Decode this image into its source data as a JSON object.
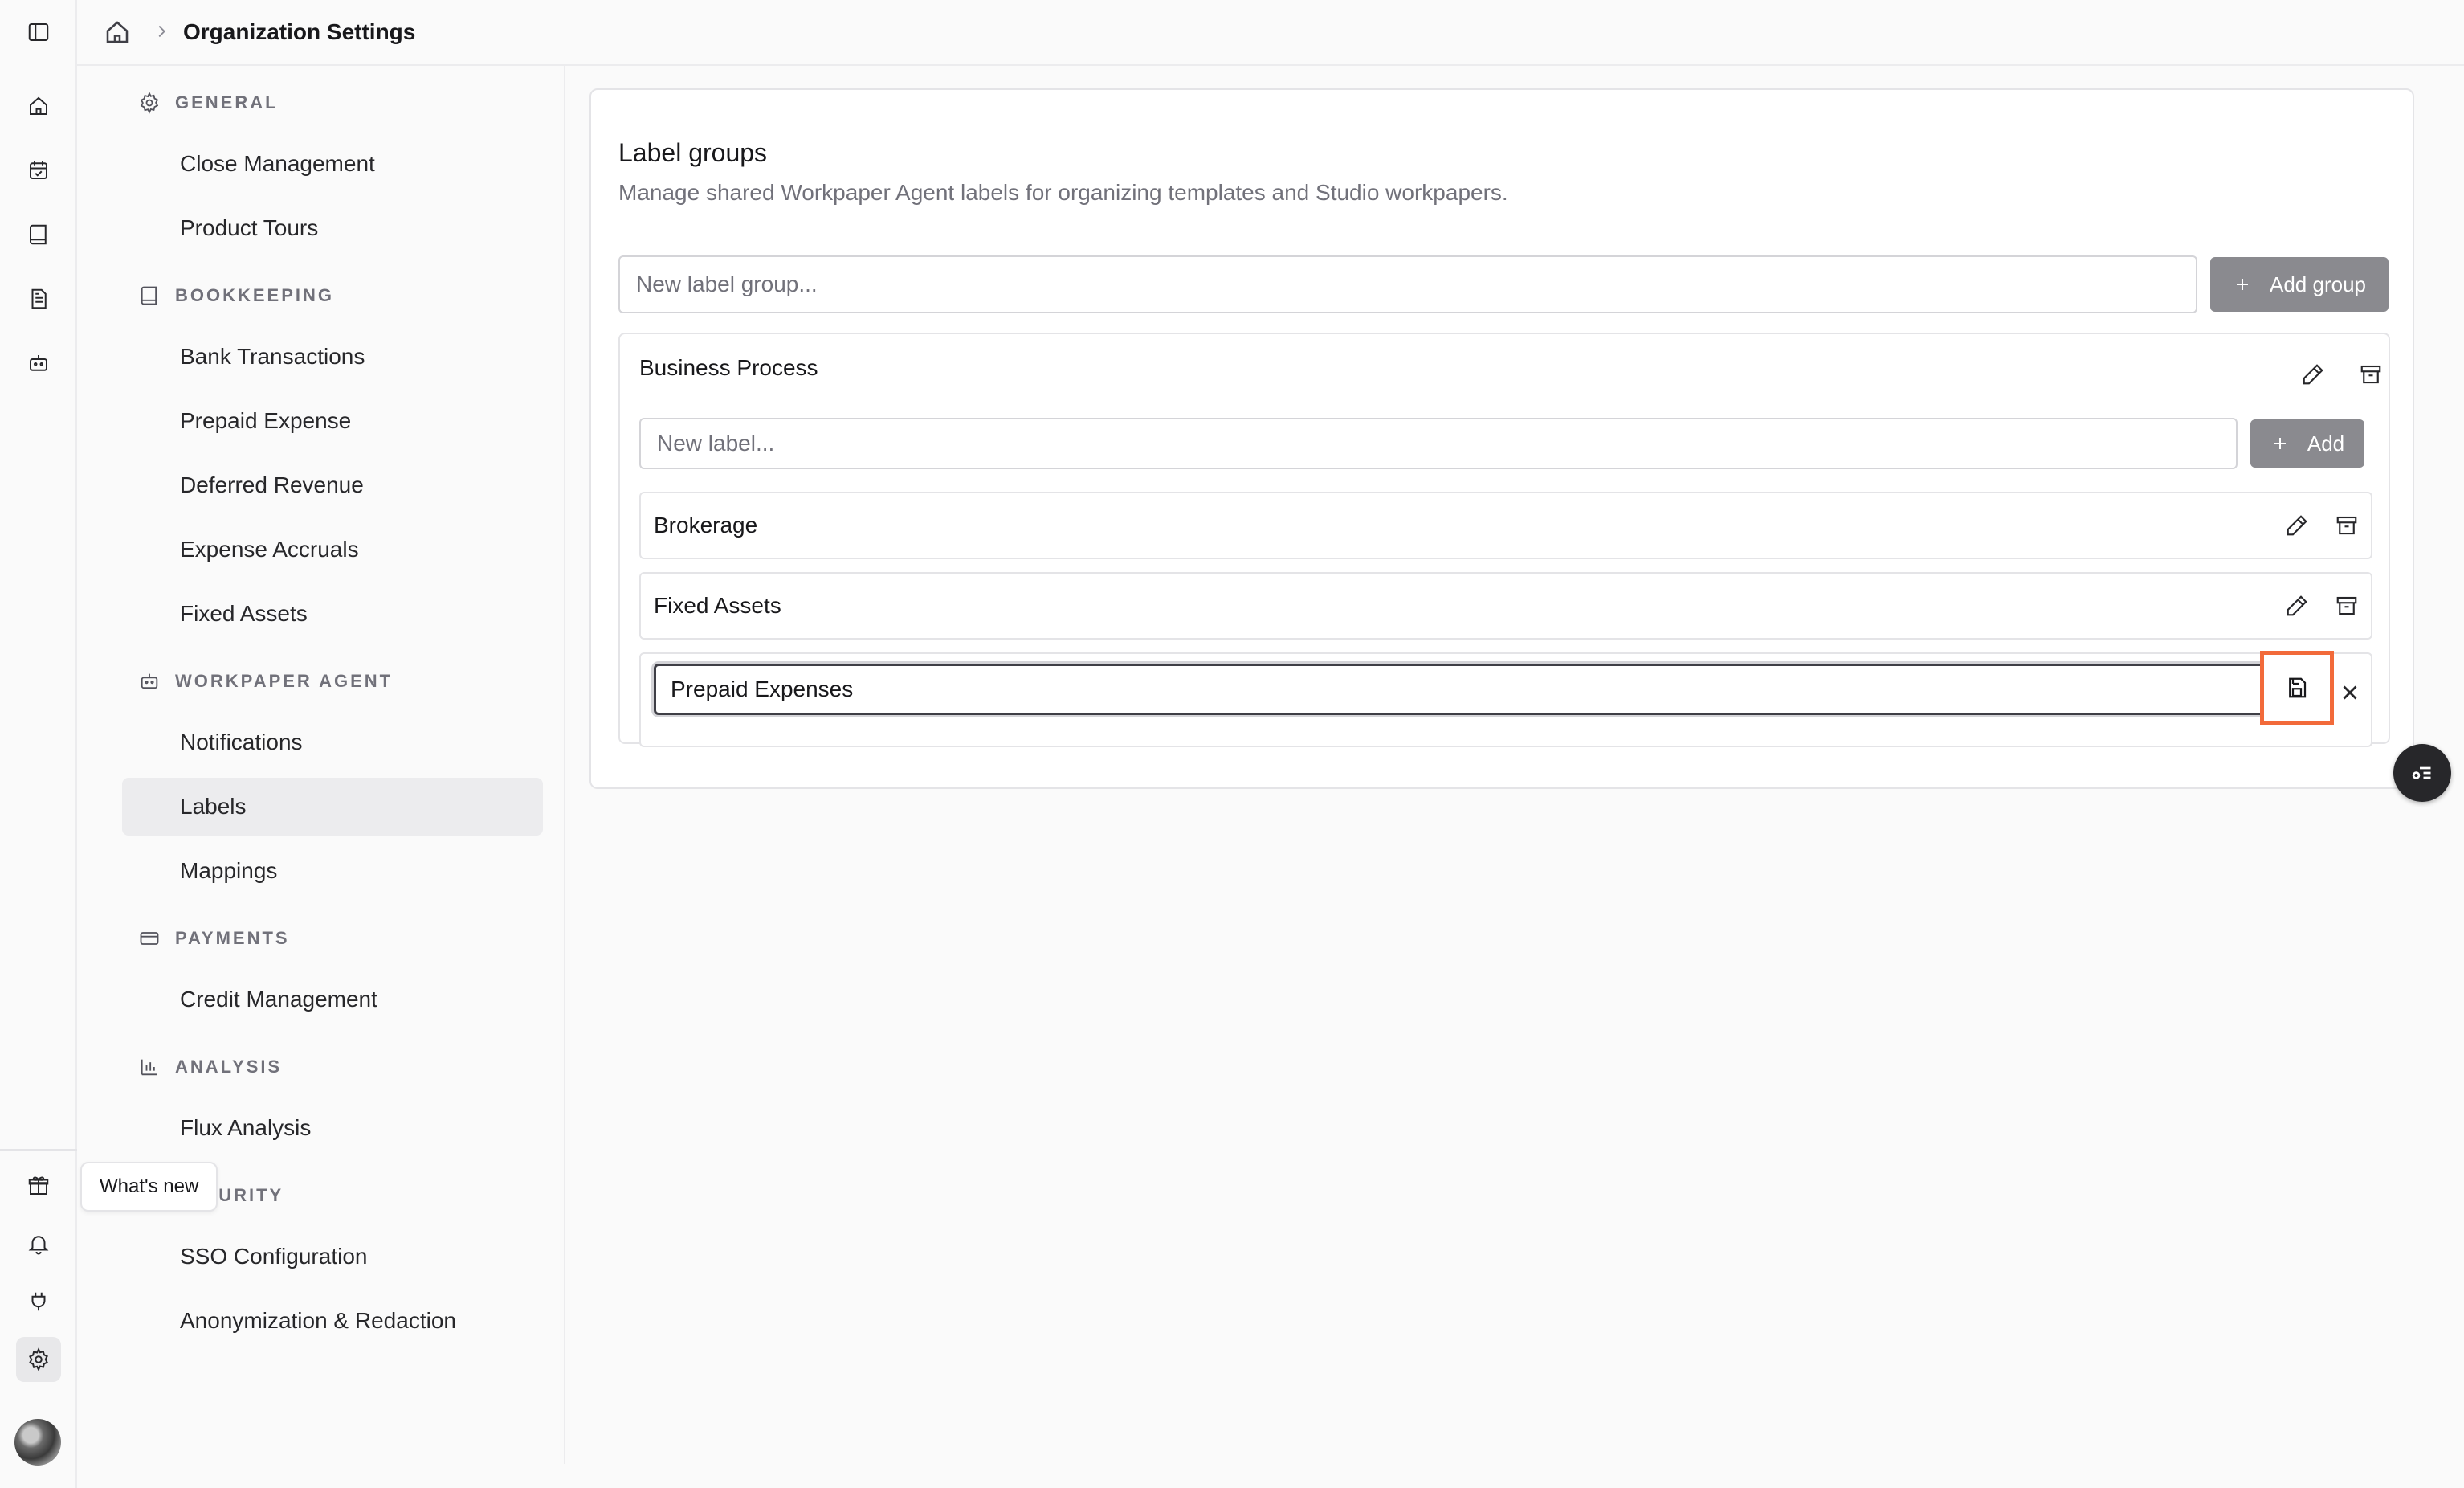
{
  "breadcrumb": {
    "title": "Organization Settings"
  },
  "rail": {
    "icons": [
      "sidebar-toggle-icon",
      "home-icon",
      "calendar-check-icon",
      "book-icon",
      "document-icon",
      "bot-icon",
      "gift-icon",
      "bell-icon",
      "plug-icon",
      "gear-icon"
    ],
    "tooltip": "What's new"
  },
  "nav": {
    "sections": [
      {
        "title": "GENERAL",
        "icon": "gear-icon",
        "items": [
          "Close Management",
          "Product Tours"
        ]
      },
      {
        "title": "BOOKKEEPING",
        "icon": "book-icon",
        "items": [
          "Bank Transactions",
          "Prepaid Expense",
          "Deferred Revenue",
          "Expense Accruals",
          "Fixed Assets"
        ]
      },
      {
        "title": "WORKPAPER AGENT",
        "icon": "bot-icon",
        "items": [
          "Notifications",
          "Labels",
          "Mappings"
        ]
      },
      {
        "title": "PAYMENTS",
        "icon": "credit-card-icon",
        "items": [
          "Credit Management"
        ]
      },
      {
        "title": "ANALYSIS",
        "icon": "bar-chart-icon",
        "items": [
          "Flux Analysis"
        ]
      },
      {
        "title": "SECURITY",
        "icon": "shield-icon",
        "items": [
          "SSO Configuration",
          "Anonymization & Redaction"
        ]
      }
    ],
    "active_item": "Labels"
  },
  "main": {
    "title": "Label groups",
    "subtitle": "Manage shared Workpaper Agent labels for organizing templates and Studio workpapers.",
    "new_group_placeholder": "New label group...",
    "add_group_label": "Add group",
    "group": {
      "name": "Business Process",
      "new_label_placeholder": "New label...",
      "add_label": "Add",
      "labels": [
        "Brokerage",
        "Fixed Assets"
      ],
      "editing_value": "Prepaid Expenses"
    }
  },
  "colors": {
    "highlight": "#f26a3a",
    "button_gray": "#8a8a8f",
    "active_nav": "#ececee"
  }
}
